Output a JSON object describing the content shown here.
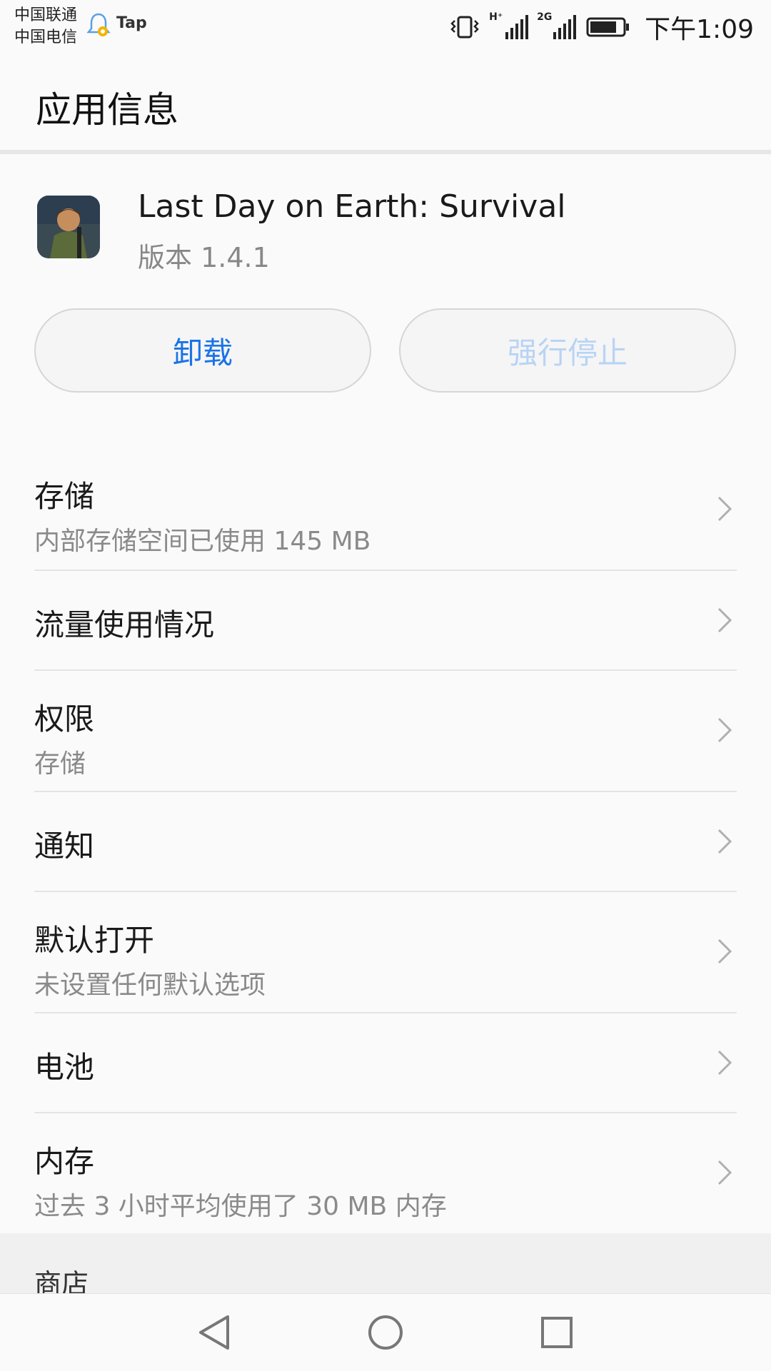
{
  "status_bar": {
    "carrier1": "中国联通",
    "carrier2": "中国电信",
    "notif_label": "Tap",
    "net1": "H⁺",
    "net2": "2G",
    "time": "下午1:09"
  },
  "header": {
    "title": "应用信息"
  },
  "app": {
    "name": "Last Day on Earth: Survival",
    "version": "版本 1.4.1"
  },
  "buttons": {
    "uninstall": "卸载",
    "force_stop": "强行停止"
  },
  "list": [
    {
      "title": "存储",
      "subtitle": "内部存储空间已使用 145 MB"
    },
    {
      "title": "流量使用情况",
      "subtitle": ""
    },
    {
      "title": "权限",
      "subtitle": "存储"
    },
    {
      "title": "通知",
      "subtitle": ""
    },
    {
      "title": "默认打开",
      "subtitle": "未设置任何默认选项"
    },
    {
      "title": "电池",
      "subtitle": ""
    },
    {
      "title": "内存",
      "subtitle": "过去 3 小时平均使用了 30 MB 内存"
    }
  ],
  "section": {
    "title": "商店"
  },
  "colors": {
    "accent": "#1a73e8",
    "disabled_text": "#b8d4f5",
    "divider": "#e4e4e4"
  },
  "icons": [
    "bell-icon",
    "vibrate-icon",
    "signal-icon",
    "battery-icon",
    "chevron-right-icon",
    "back-icon",
    "home-icon",
    "recents-icon"
  ]
}
